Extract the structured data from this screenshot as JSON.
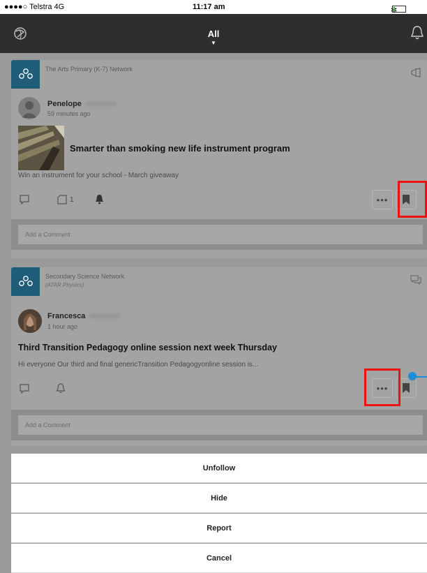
{
  "status_bar": {
    "carrier": "●●●●○ Telstra  4G",
    "time": "11:17 am",
    "battery": "✻ 11%"
  },
  "nav": {
    "title": "All"
  },
  "posts": [
    {
      "network": "The Arts Primary (K-7) Network",
      "author": "Penelope",
      "time": "59 minutes ago",
      "title": "Smarter than smoking new life instrument program",
      "summary": "Win an instrument for your school - March giveaway",
      "count": "1",
      "comment_placeholder": "Add a Comment"
    },
    {
      "network": "Secondary Science Network",
      "network_sub": "(ATAR Physics)",
      "author": "Francesca",
      "time": "1 hour ago",
      "title": "Third Transition Pedagogy online session next week Thursday",
      "summary": "Hi everyone Our third and final genericTransition Pedagogyonline session is...",
      "comment_placeholder": "Add a Comment"
    }
  ],
  "action_sheet": {
    "unfollow": "Unfollow",
    "hide": "Hide",
    "report": "Report",
    "cancel": "Cancel"
  },
  "colors": {
    "highlight": "#ee1111",
    "tap_indicator": "#1c8fd8",
    "navbar": "#2e2e2e",
    "network_logo": "#1f5d78"
  }
}
